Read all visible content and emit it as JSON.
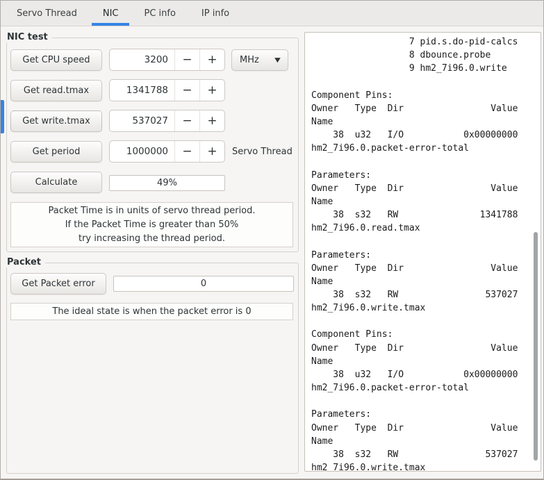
{
  "tabs": {
    "active_label": "NIC",
    "items": [
      {
        "label": "Servo Thread"
      },
      {
        "label": "NIC"
      },
      {
        "label": "PC info"
      },
      {
        "label": "IP info"
      }
    ]
  },
  "nic_test": {
    "label": "NIC test",
    "cpu": {
      "button": "Get CPU speed",
      "value": "3200",
      "unit": "MHz"
    },
    "read": {
      "button": "Get read.tmax",
      "value": "1341788"
    },
    "write": {
      "button": "Get write.tmax",
      "value": "537027"
    },
    "period": {
      "button": "Get period",
      "value": "1000000",
      "suffix": "Servo Thread"
    },
    "calculate": {
      "button": "Calculate",
      "result": "49%"
    },
    "note": {
      "line1": "Packet Time is in units of servo thread period.",
      "line2": "If the Packet Time is greater than 50%",
      "line3": "try increasing the thread period."
    }
  },
  "packet": {
    "label": "Packet",
    "button": "Get Packet error",
    "value": "0",
    "note": "The ideal state is when the packet error is 0"
  },
  "output": {
    "text": "                  7 pid.s.do-pid-calcs\n                  8 dbounce.probe\n                  9 hm2_7i96.0.write\n\nComponent Pins:\nOwner   Type  Dir                Value\nName\n    38  u32   I/O           0x00000000\nhm2_7i96.0.packet-error-total\n\nParameters:\nOwner   Type  Dir                Value\nName\n    38  s32   RW               1341788\nhm2_7i96.0.read.tmax\n\nParameters:\nOwner   Type  Dir                Value\nName\n    38  s32   RW                537027\nhm2_7i96.0.write.tmax\n\nComponent Pins:\nOwner   Type  Dir                Value\nName\n    38  u32   I/O           0x00000000\nhm2_7i96.0.packet-error-total\n\nParameters:\nOwner   Type  Dir                Value\nName\n    38  s32   RW                537027\nhm2_7i96.0.write.tmax"
  },
  "icons": {
    "minus": "−",
    "plus": "+",
    "dropdown": "▼"
  },
  "colors": {
    "accent": "#3584e4",
    "window_bg": "#f6f5f4"
  }
}
